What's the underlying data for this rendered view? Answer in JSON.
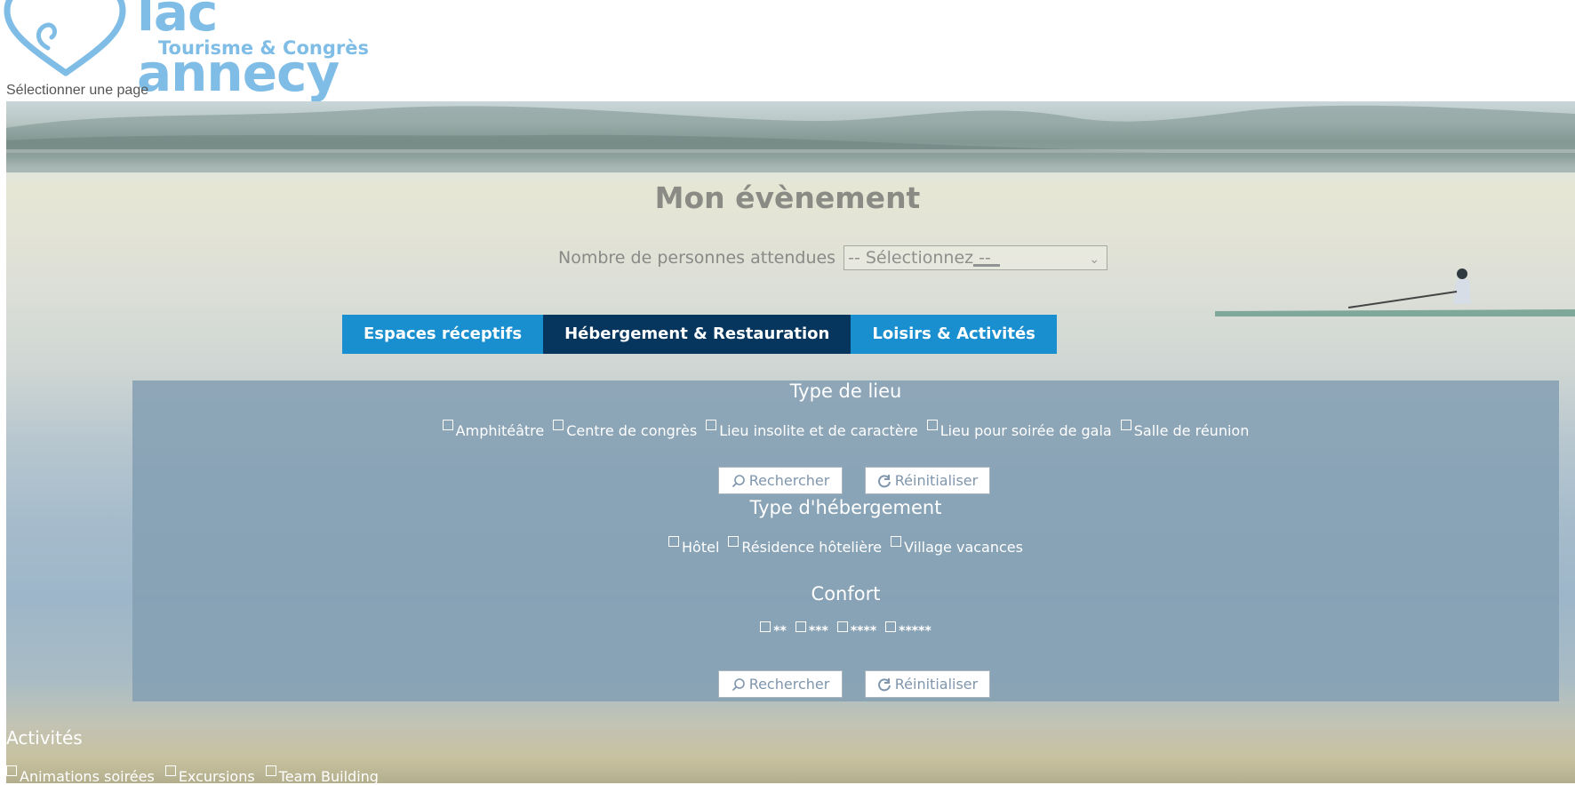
{
  "brand": {
    "name": "lac annecy",
    "subtitle": "Tourisme & Congrès",
    "color": "#7fbde6"
  },
  "page_select": "Sélectionner une page",
  "event": {
    "title": "Mon évènement",
    "persons_label": "Nombre de personnes attendues",
    "persons_select": "-- Sélectionnez --"
  },
  "tabs": [
    {
      "label": "Espaces réceptifs",
      "active": false
    },
    {
      "label": "Hébergement & Restauration",
      "active": true
    },
    {
      "label": "Loisirs & Activités",
      "active": false
    }
  ],
  "colors": {
    "tab": "#1a8fcf",
    "tab_active": "#06365e"
  },
  "type_lieu": {
    "title": "Type de lieu",
    "options": [
      "Amphitéâtre",
      "Centre de congrès",
      "Lieu insolite et de caractère",
      "Lieu pour soirée de gala",
      "Salle de réunion"
    ]
  },
  "type_hebergement": {
    "title": "Type d'hébergement",
    "options": [
      "Hôtel",
      "Résidence hôtelière",
      "Village vacances"
    ]
  },
  "confort": {
    "title": "Confort",
    "options": [
      "**",
      "***",
      "****",
      "*****"
    ]
  },
  "buttons": {
    "search": "Rechercher",
    "reset": "Réinitialiser",
    "search_icon": "search-icon",
    "reset_icon": "refresh-icon"
  },
  "activites": {
    "title": "Activités",
    "options": [
      "Animations soirées",
      "Excursions",
      "Team Building"
    ]
  }
}
